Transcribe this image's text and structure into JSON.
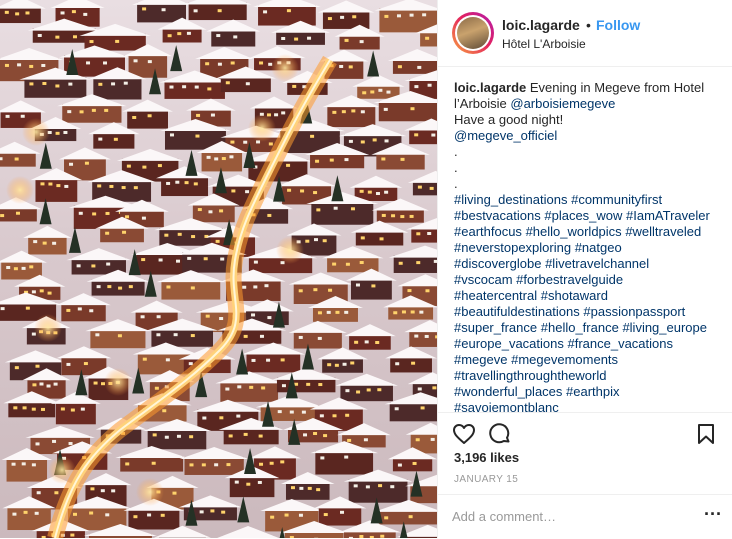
{
  "post": {
    "photo_alt": "",
    "author": {
      "username": "loic.lagarde",
      "separator": "•",
      "follow_label": "Follow",
      "location": "Hôtel L'Arboisie"
    },
    "caption": {
      "username": "loic.lagarde",
      "lines": [
        "Evening in Megeve from Hotel",
        "l’Arboisie @arboisiemegeve",
        "Have a good night!",
        "@megeve_officiel",
        ".",
        ".",
        ".",
        "#living_destinations #communityfirst",
        "#bestvacations #places_wow #IamATraveler",
        "#earthfocus #hello_worldpics #welltraveled",
        "#neverstopexploring #natgeo",
        "#discoverglobe #livetravelchannel",
        "#vscocam #forbestravelguide",
        "#heatercentral #shotaward",
        "#beautifuldestinations #passionpassport",
        "#super_france #hello_france #living_europe",
        "#europe_vacations #france_vacations",
        "#megeve #megevemoments",
        "#travellingthroughtheworld",
        "#wonderful_places #earthpix",
        "#savoiemontblanc"
      ]
    },
    "actions": {
      "like_icon": "heart-icon",
      "comment_icon": "comment-bubble-icon",
      "save_icon": "bookmark-icon"
    },
    "likes": "3,196 likes",
    "date": "JANUARY 15",
    "comment": {
      "placeholder": "Add a comment…",
      "more_label": "···"
    },
    "colors": {
      "accent": "#3897f0",
      "link": "#003569",
      "text": "#262626",
      "muted": "#999999",
      "divider": "#efefef"
    }
  }
}
